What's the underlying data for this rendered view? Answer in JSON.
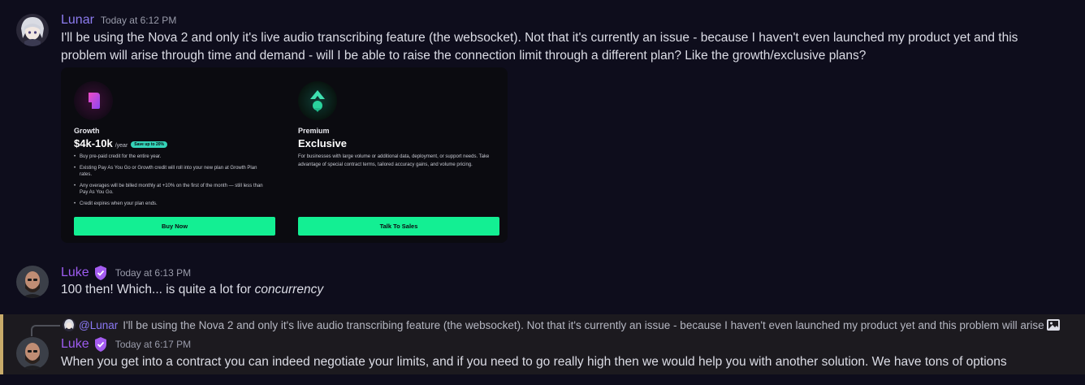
{
  "messages": [
    {
      "author": "Lunar",
      "author_color": "#8d7cf0",
      "timestamp": "Today at 6:12 PM",
      "text": "I'll be using the Nova 2 and only it's live audio transcribing feature (the websocket). Not that it's currently an issue - because I haven't even launched my product yet and this problem will arise through time and demand - will I be able to raise the connection limit through a different plan? Like the growth/exclusive plans?",
      "embed": {
        "plans": [
          {
            "kicker": "Growth",
            "price": "$4k-10k",
            "per": "/year",
            "badge": "Save up to 20%",
            "bullets": [
              "Buy pre-paid credit for the entire year.",
              "Existing Pay As You Go or Growth credit will roll into your new plan at Growth Plan rates.",
              "Any overages will be billed monthly at +10% on the first of the month — still less than Pay As You Go.",
              "Credit expires when your plan ends."
            ],
            "button": "Buy Now"
          },
          {
            "kicker": "Premium",
            "price": "Exclusive",
            "description": "For businesses with large volume or additional data, deployment, or support needs. Take advantage of special contract terms, tailored accuracy gains, and volume pricing.",
            "button": "Talk To Sales"
          }
        ]
      }
    },
    {
      "author": "Luke",
      "author_color": "#9d5cf0",
      "timestamp": "Today at 6:13 PM",
      "text_plain": "100 then! Which... is quite a lot for ",
      "text_italic": "concurrency"
    },
    {
      "author": "Luke",
      "author_color": "#9d5cf0",
      "timestamp": "Today at 6:17 PM",
      "reply_to": {
        "mention": "@Lunar",
        "snippet": "I'll be using the Nova 2 and only it's live audio transcribing feature (the websocket). Not that it's currently an issue - because I haven't even launched my product yet and this problem will arise thro"
      },
      "text": "When you get into a contract you can indeed negotiate your limits, and if you need to go really high then we would help you with another solution. We have tons of options"
    }
  ],
  "icons": {
    "staff_badge": "shield-check-icon",
    "attachment": "image-icon"
  }
}
